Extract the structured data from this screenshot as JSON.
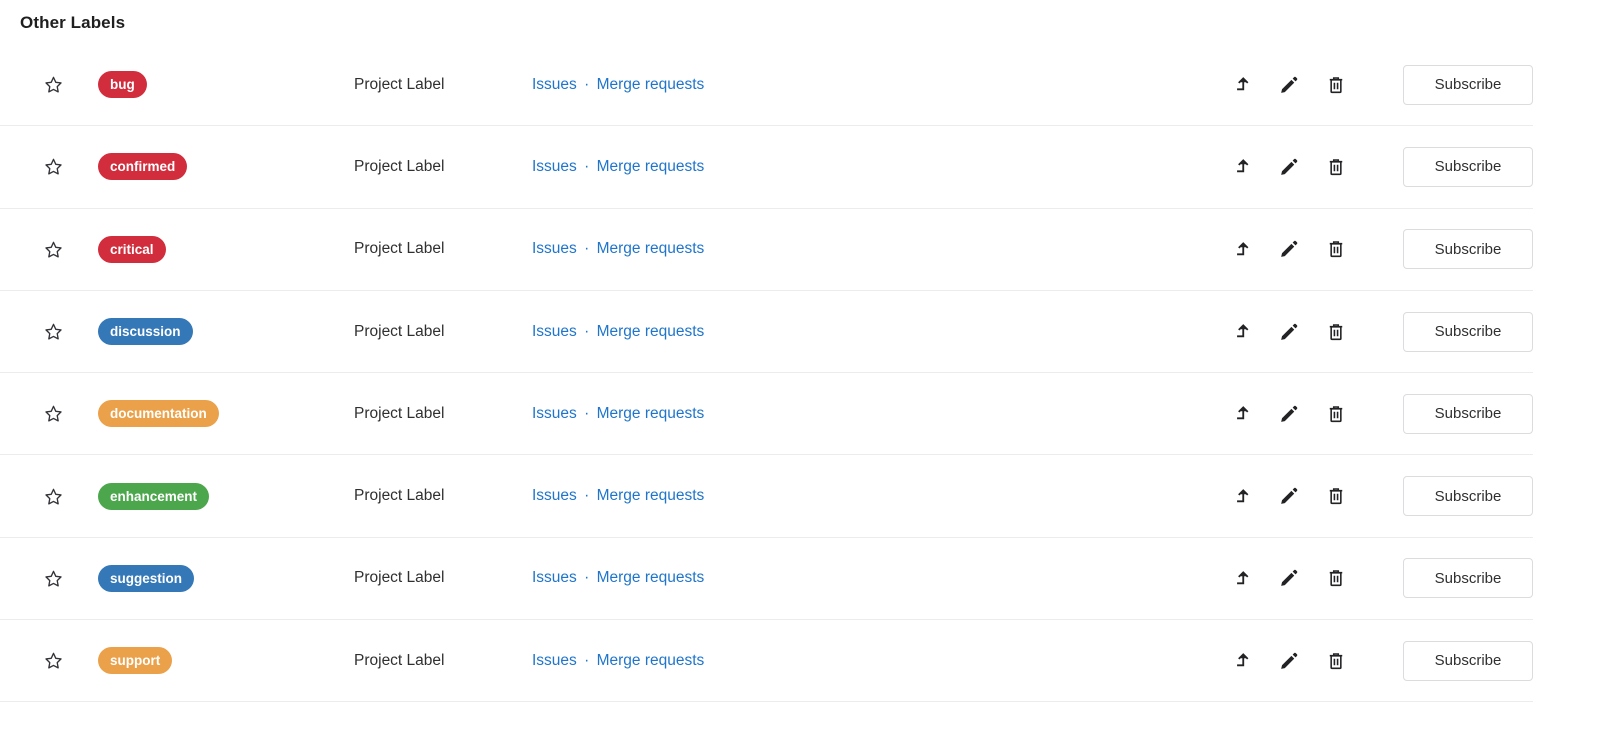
{
  "section": {
    "title": "Other Labels"
  },
  "columns": {
    "type_label": "Project Label",
    "issues_link": "Issues",
    "separator": "·",
    "merge_requests_link": "Merge requests"
  },
  "actions": {
    "star_icon": "star-outline-icon",
    "promote_icon": "promote-level-up-icon",
    "edit_icon": "pencil-icon",
    "delete_icon": "trash-icon",
    "subscribe_label": "Subscribe"
  },
  "colors": {
    "red": "#d22d3d",
    "red_alt": "#d9363e",
    "blue": "#3478b8",
    "orange": "#eaa14a",
    "green": "#4ca64c",
    "link": "#1f75cb",
    "text": "#303030",
    "border": "#ececef",
    "button_border": "#dcdcde"
  },
  "labels": [
    {
      "name": "bug",
      "color": "#d22d3d",
      "type": "Project Label",
      "issues": "Issues",
      "merge_requests": "Merge requests",
      "subscribe": "Subscribe"
    },
    {
      "name": "confirmed",
      "color": "#d22d3d",
      "type": "Project Label",
      "issues": "Issues",
      "merge_requests": "Merge requests",
      "subscribe": "Subscribe"
    },
    {
      "name": "critical",
      "color": "#d22d3d",
      "type": "Project Label",
      "issues": "Issues",
      "merge_requests": "Merge requests",
      "subscribe": "Subscribe"
    },
    {
      "name": "discussion",
      "color": "#3478b8",
      "type": "Project Label",
      "issues": "Issues",
      "merge_requests": "Merge requests",
      "subscribe": "Subscribe"
    },
    {
      "name": "documentation",
      "color": "#eaa14a",
      "type": "Project Label",
      "issues": "Issues",
      "merge_requests": "Merge requests",
      "subscribe": "Subscribe"
    },
    {
      "name": "enhancement",
      "color": "#4ca64c",
      "type": "Project Label",
      "issues": "Issues",
      "merge_requests": "Merge requests",
      "subscribe": "Subscribe"
    },
    {
      "name": "suggestion",
      "color": "#3478b8",
      "type": "Project Label",
      "issues": "Issues",
      "merge_requests": "Merge requests",
      "subscribe": "Subscribe"
    },
    {
      "name": "support",
      "color": "#eaa14a",
      "type": "Project Label",
      "issues": "Issues",
      "merge_requests": "Merge requests",
      "subscribe": "Subscribe"
    }
  ]
}
